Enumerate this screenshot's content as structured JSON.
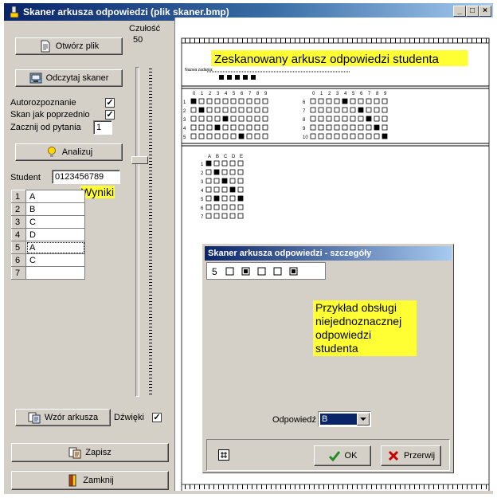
{
  "window": {
    "title": "Skaner arkusza odpowiedzi (plik skaner.bmp)",
    "controls": [
      "_",
      "□",
      "×"
    ]
  },
  "left": {
    "open_label": "Otwórz plik",
    "sensitivity_label": "Czułość",
    "sensitivity_value": "50",
    "read_scanner_label": "Odczytaj skaner",
    "autorecognition_label": "Autorozpoznanie",
    "scan_as_before_label": "Skan jak poprzednio",
    "start_question_label": "Zacznij od pytania",
    "start_question_value": "1",
    "analyze_label": "Analizuj",
    "student_label": "Student",
    "student_value": "0123456789",
    "results_label": "Wyniki",
    "results": [
      {
        "n": "1",
        "v": "A"
      },
      {
        "n": "2",
        "v": "B"
      },
      {
        "n": "3",
        "v": "C"
      },
      {
        "n": "4",
        "v": "D"
      },
      {
        "n": "5",
        "v": "A"
      },
      {
        "n": "6",
        "v": "C"
      },
      {
        "n": "7",
        "v": ""
      }
    ],
    "template_label": "Wzór arkusza",
    "sounds_label": "Dźwięki",
    "save_label": "Zapisz",
    "close_label": "Zamknij"
  },
  "sheet": {
    "caption": "Zeskanowany arkusz odpowiedzi studenta",
    "name_label": "Nazwa zadania:",
    "digits": [
      "0",
      "1",
      "2",
      "3",
      "4",
      "5",
      "6",
      "7",
      "8",
      "9"
    ],
    "rows_left": [
      "1",
      "2",
      "3",
      "4",
      "5"
    ],
    "rows_right": [
      "6",
      "7",
      "8",
      "9",
      "10"
    ],
    "letters": [
      "A",
      "B",
      "C",
      "D",
      "E"
    ],
    "question_rows": [
      "1",
      "2",
      "3",
      "4",
      "5",
      "6",
      "7"
    ]
  },
  "dialog": {
    "title": "Skaner arkusza odpowiedzi - szczegóły",
    "question_no": "5",
    "note": "Przykład obsługi niejednoznacznej odpowiedzi studenta",
    "answer_label": "Odpowiedź",
    "answer_value": "B",
    "ok_label": "OK",
    "cancel_label": "Przerwij"
  },
  "colors": {
    "highlight": "#ffff33",
    "title_bar": "#0a246a"
  }
}
